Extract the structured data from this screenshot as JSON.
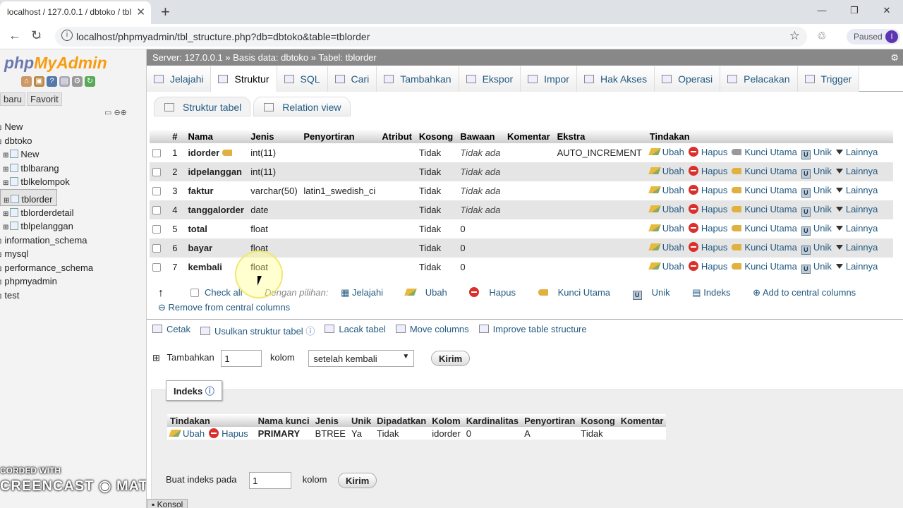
{
  "browser": {
    "tab_title": "localhost / 127.0.0.1 / dbtoko / tbl",
    "new_tab": "+",
    "url": "localhost/phpmyadmin/tbl_structure.php?db=dbtoko&table=tblorder",
    "profile_status": "Paused",
    "profile_initial": "I"
  },
  "sidebar": {
    "logo_php": "php",
    "logo_myadmin": "MyAdmin",
    "tabs": [
      "baru",
      "Favorit"
    ],
    "tree": [
      {
        "label": "New",
        "indent": 0
      },
      {
        "label": "dbtoko",
        "indent": 0
      },
      {
        "label": "New",
        "indent": 1
      },
      {
        "label": "tblbarang",
        "indent": 1
      },
      {
        "label": "tblkelompok",
        "indent": 1
      },
      {
        "label": "tblorder",
        "indent": 1,
        "selected": true
      },
      {
        "label": "tblorderdetail",
        "indent": 1
      },
      {
        "label": "tblpelanggan",
        "indent": 1
      },
      {
        "label": "information_schema",
        "indent": 0
      },
      {
        "label": "mysql",
        "indent": 0
      },
      {
        "label": "performance_schema",
        "indent": 0
      },
      {
        "label": "phpmyadmin",
        "indent": 0
      },
      {
        "label": "test",
        "indent": 0
      }
    ],
    "watermark_line1": "CORDED WITH",
    "watermark_line2": "CREENCAST ◉ MATIC"
  },
  "breadcrumb": "Server: 127.0.0.1 » Basis data: dbtoko » Tabel: tblorder",
  "tabs": [
    "Jelajahi",
    "Struktur",
    "SQL",
    "Cari",
    "Tambahkan",
    "Ekspor",
    "Impor",
    "Hak Akses",
    "Operasi",
    "Pelacakan",
    "Trigger"
  ],
  "active_tab": "Struktur",
  "subtabs": [
    "Struktur tabel",
    "Relation view"
  ],
  "structure": {
    "headers": [
      "#",
      "Nama",
      "Jenis",
      "Penyortiran",
      "Atribut",
      "Kosong",
      "Bawaan",
      "Komentar",
      "Ekstra",
      "Tindakan"
    ],
    "rows": [
      {
        "no": "1",
        "name": "idorder",
        "type": "int(11)",
        "collation": "",
        "attr": "",
        "null": "Tidak",
        "default": "Tidak ada",
        "comment": "",
        "extra": "AUTO_INCREMENT"
      },
      {
        "no": "2",
        "name": "idpelanggan",
        "type": "int(11)",
        "collation": "",
        "attr": "",
        "null": "Tidak",
        "default": "Tidak ada",
        "comment": "",
        "extra": ""
      },
      {
        "no": "3",
        "name": "faktur",
        "type": "varchar(50)",
        "collation": "latin1_swedish_ci",
        "attr": "",
        "null": "Tidak",
        "default": "Tidak ada",
        "comment": "",
        "extra": ""
      },
      {
        "no": "4",
        "name": "tanggalorder",
        "type": "date",
        "collation": "",
        "attr": "",
        "null": "Tidak",
        "default": "Tidak ada",
        "comment": "",
        "extra": ""
      },
      {
        "no": "5",
        "name": "total",
        "type": "float",
        "collation": "",
        "attr": "",
        "null": "Tidak",
        "default": "0",
        "comment": "",
        "extra": ""
      },
      {
        "no": "6",
        "name": "bayar",
        "type": "float",
        "collation": "",
        "attr": "",
        "null": "Tidak",
        "default": "0",
        "comment": "",
        "extra": ""
      },
      {
        "no": "7",
        "name": "kembali",
        "type": "float",
        "collation": "",
        "attr": "",
        "null": "Tidak",
        "default": "0",
        "comment": "",
        "extra": ""
      }
    ],
    "actions": {
      "edit": "Ubah",
      "drop": "Hapus",
      "primary": "Kunci Utama",
      "unique": "Unik",
      "more": "Lainnya"
    }
  },
  "bulk": {
    "check_all": "Check all",
    "with_selected": "Dengan pilihan:",
    "items": [
      "Jelajahi",
      "Ubah",
      "Hapus",
      "Kunci Utama",
      "Unik",
      "Indeks",
      "Add to central columns"
    ],
    "remove_central": "Remove from central columns"
  },
  "tools": [
    "Cetak",
    "Usulkan struktur tabel",
    "Lacak tabel",
    "Move columns",
    "Improve table structure"
  ],
  "add_columns": {
    "label": "Tambahkan",
    "count": "1",
    "unit": "kolom",
    "position": "setelah kembali",
    "submit": "Kirim"
  },
  "indexes": {
    "legend": "Indeks",
    "headers": [
      "Tindakan",
      "Nama kunci",
      "Jenis",
      "Unik",
      "Dipadatkan",
      "Kolom",
      "Kardinalitas",
      "Penyortiran",
      "Kosong",
      "Komentar"
    ],
    "row": {
      "edit": "Ubah",
      "drop": "Hapus",
      "key": "PRIMARY",
      "type": "BTREE",
      "unique": "Ya",
      "packed": "Tidak",
      "column": "idorder",
      "cardinality": "0",
      "collation": "A",
      "null": "Tidak",
      "comment": ""
    },
    "create_label": "Buat indeks pada",
    "create_count": "1",
    "create_unit": "kolom",
    "create_submit": "Kirim"
  },
  "console": "Konsol"
}
